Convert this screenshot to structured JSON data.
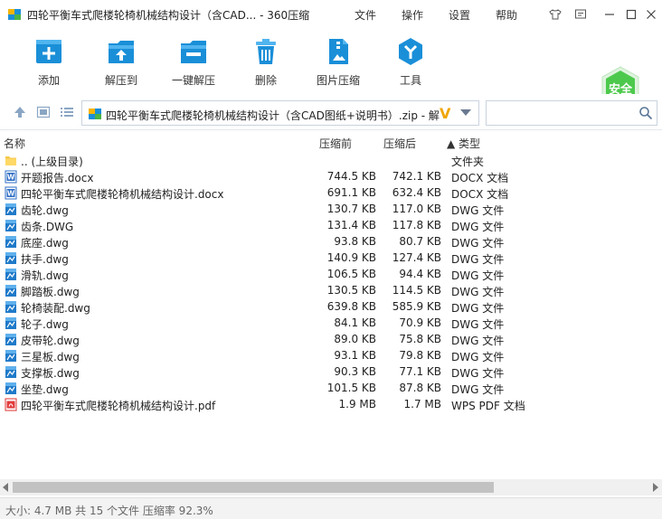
{
  "titlebar": {
    "title": "四轮平衡车式爬楼轮椅机械结构设计（含CAD... - 360压缩",
    "menus": [
      "文件",
      "操作",
      "设置",
      "帮助"
    ]
  },
  "toolbar": {
    "buttons": [
      {
        "label": "添加",
        "icon": "add-icon"
      },
      {
        "label": "解压到",
        "icon": "extract-to-icon"
      },
      {
        "label": "一键解压",
        "icon": "one-click-extract-icon"
      },
      {
        "label": "删除",
        "icon": "delete-icon"
      },
      {
        "label": "图片压缩",
        "icon": "image-compress-icon"
      },
      {
        "label": "工具",
        "icon": "tools-icon"
      }
    ],
    "safe_label": "安全"
  },
  "address": {
    "path": "四轮平衡车式爬楼轮椅机械结构设计（含CAD图纸+说明书）.zip - 解",
    "search_placeholder": ""
  },
  "list": {
    "columns": {
      "name": "名称",
      "size": "压缩前",
      "compressed": "压缩后",
      "type": "▲ 类型"
    },
    "rows": [
      {
        "name": ".. (上级目录)",
        "size": "",
        "compressed": "",
        "type": "文件夹",
        "kind": "folder"
      },
      {
        "name": "开题报告.docx",
        "size": "744.5 KB",
        "compressed": "742.1 KB",
        "type": "DOCX 文档",
        "kind": "docx"
      },
      {
        "name": "四轮平衡车式爬楼轮椅机械结构设计.docx",
        "size": "691.1 KB",
        "compressed": "632.4 KB",
        "type": "DOCX 文档",
        "kind": "docx"
      },
      {
        "name": "齿轮.dwg",
        "size": "130.7 KB",
        "compressed": "117.0 KB",
        "type": "DWG 文件",
        "kind": "dwg"
      },
      {
        "name": "齿条.DWG",
        "size": "131.4 KB",
        "compressed": "117.8 KB",
        "type": "DWG 文件",
        "kind": "dwg"
      },
      {
        "name": "底座.dwg",
        "size": "93.8 KB",
        "compressed": "80.7 KB",
        "type": "DWG 文件",
        "kind": "dwg"
      },
      {
        "name": "扶手.dwg",
        "size": "140.9 KB",
        "compressed": "127.4 KB",
        "type": "DWG 文件",
        "kind": "dwg"
      },
      {
        "name": "滑轨.dwg",
        "size": "106.5 KB",
        "compressed": "94.4 KB",
        "type": "DWG 文件",
        "kind": "dwg"
      },
      {
        "name": "脚踏板.dwg",
        "size": "130.5 KB",
        "compressed": "114.5 KB",
        "type": "DWG 文件",
        "kind": "dwg"
      },
      {
        "name": "轮椅装配.dwg",
        "size": "639.8 KB",
        "compressed": "585.9 KB",
        "type": "DWG 文件",
        "kind": "dwg"
      },
      {
        "name": "轮子.dwg",
        "size": "84.1 KB",
        "compressed": "70.9 KB",
        "type": "DWG 文件",
        "kind": "dwg"
      },
      {
        "name": "皮带轮.dwg",
        "size": "89.0 KB",
        "compressed": "75.8 KB",
        "type": "DWG 文件",
        "kind": "dwg"
      },
      {
        "name": "三星板.dwg",
        "size": "93.1 KB",
        "compressed": "79.8 KB",
        "type": "DWG 文件",
        "kind": "dwg"
      },
      {
        "name": "支撑板.dwg",
        "size": "90.3 KB",
        "compressed": "77.1 KB",
        "type": "DWG 文件",
        "kind": "dwg"
      },
      {
        "name": "坐垫.dwg",
        "size": "101.5 KB",
        "compressed": "87.8 KB",
        "type": "DWG 文件",
        "kind": "dwg"
      },
      {
        "name": "四轮平衡车式爬楼轮椅机械结构设计.pdf",
        "size": "1.9 MB",
        "compressed": "1.7 MB",
        "type": "WPS PDF 文档",
        "kind": "pdf"
      }
    ]
  },
  "status": {
    "text": "大小: 4.7 MB 共 15 个文件 压缩率 92.3%"
  },
  "colors": {
    "accent": "#1a8fd8",
    "safe_green": "#4cc94c"
  }
}
